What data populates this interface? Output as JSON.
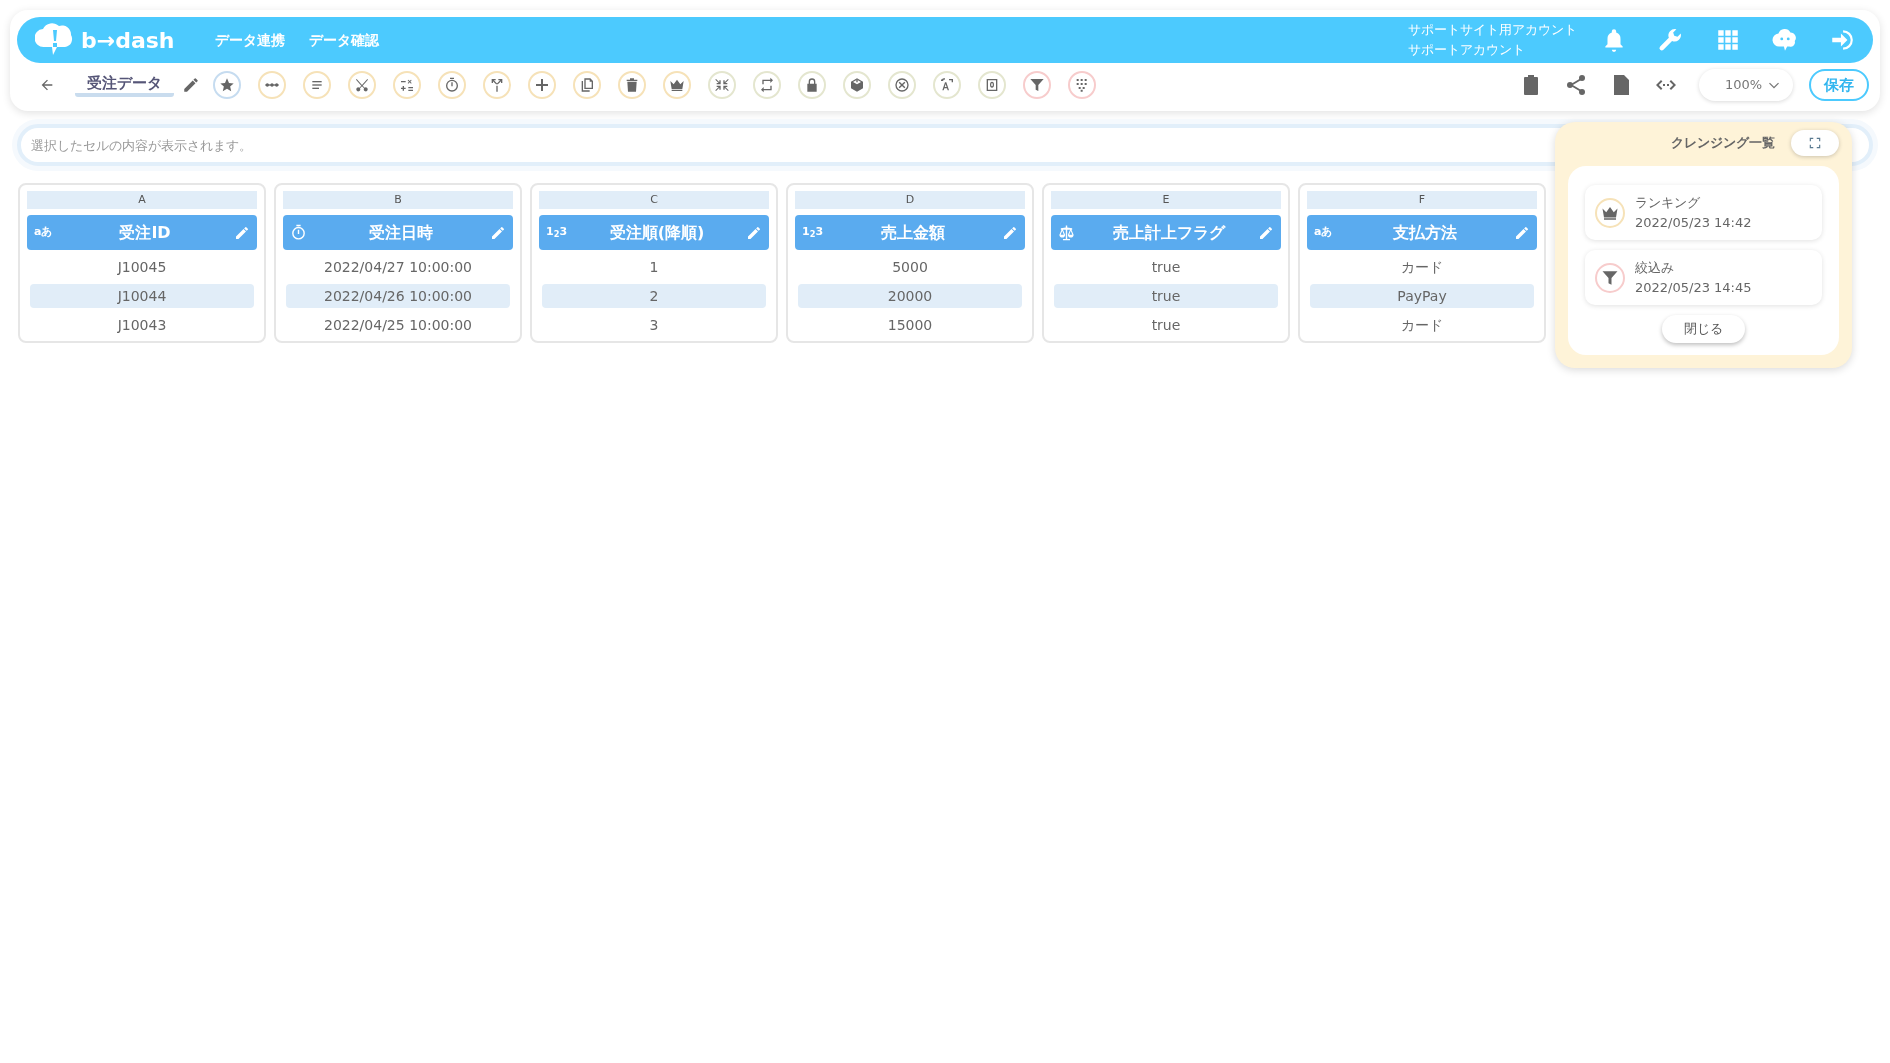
{
  "header": {
    "logo_text": "b→dash",
    "nav": [
      "データ連携",
      "データ確認"
    ],
    "account_lines": [
      "サポートサイト用アカウント",
      "サポートアカウント"
    ]
  },
  "toolbar": {
    "title": "受注データ",
    "tools": [
      {
        "color": "#c6dcf0"
      },
      {
        "color": "#f6e2b8"
      },
      {
        "color": "#f6e2b8"
      },
      {
        "color": "#f6e2b8"
      },
      {
        "color": "#f6e2b8"
      },
      {
        "color": "#f6e2b8"
      },
      {
        "color": "#f6e2b8"
      },
      {
        "color": "#f6e2b8"
      },
      {
        "color": "#f6e2b8"
      },
      {
        "color": "#f6e2b8"
      },
      {
        "color": "#f6e2b8"
      },
      {
        "color": "#e4e6cf"
      },
      {
        "color": "#e4e6cf"
      },
      {
        "color": "#e4e6cf"
      },
      {
        "color": "#e4e6cf"
      },
      {
        "color": "#e4e6cf"
      },
      {
        "color": "#e4e6cf"
      },
      {
        "color": "#e4e6cf"
      },
      {
        "color": "#f7cccc"
      },
      {
        "color": "#f7cccc"
      }
    ],
    "zoom": "100%",
    "save": "保存"
  },
  "formula_bar": {
    "placeholder": "選択したセルの内容が表示されます。"
  },
  "columns": [
    {
      "letter": "A",
      "kind": "text",
      "type_label": "aあ",
      "name": "受注ID",
      "cells": [
        "J10045",
        "J10044",
        "J10043"
      ]
    },
    {
      "letter": "B",
      "kind": "datetime",
      "name": "受注日時",
      "cells": [
        "2022/04/27 10:00:00",
        "2022/04/26 10:00:00",
        "2022/04/25 10:00:00"
      ]
    },
    {
      "letter": "C",
      "kind": "number",
      "type_label": "1$_{2}$3",
      "name": "受注順(降順)",
      "cells": [
        "1",
        "2",
        "3"
      ]
    },
    {
      "letter": "D",
      "kind": "number",
      "type_label": "1$_{2}$3",
      "name": "売上金額",
      "cells": [
        "5000",
        "20000",
        "15000"
      ]
    },
    {
      "letter": "E",
      "kind": "boolean",
      "name": "売上計上フラグ",
      "cells": [
        "true",
        "true",
        "true"
      ]
    },
    {
      "letter": "F",
      "kind": "text",
      "type_label": "aあ",
      "name": "支払方法",
      "cells": [
        "カード",
        "PayPay",
        "カード"
      ]
    }
  ],
  "cleansing_panel": {
    "title": "クレンジング一覧",
    "items": [
      {
        "kind": "ranking",
        "color": "#f6e2b8",
        "name": "ランキング",
        "time": "2022/05/23 14:42"
      },
      {
        "kind": "filter",
        "color": "#f7cccc",
        "name": "絞込み",
        "time": "2022/05/23 14:45"
      }
    ],
    "close": "閉じる"
  }
}
